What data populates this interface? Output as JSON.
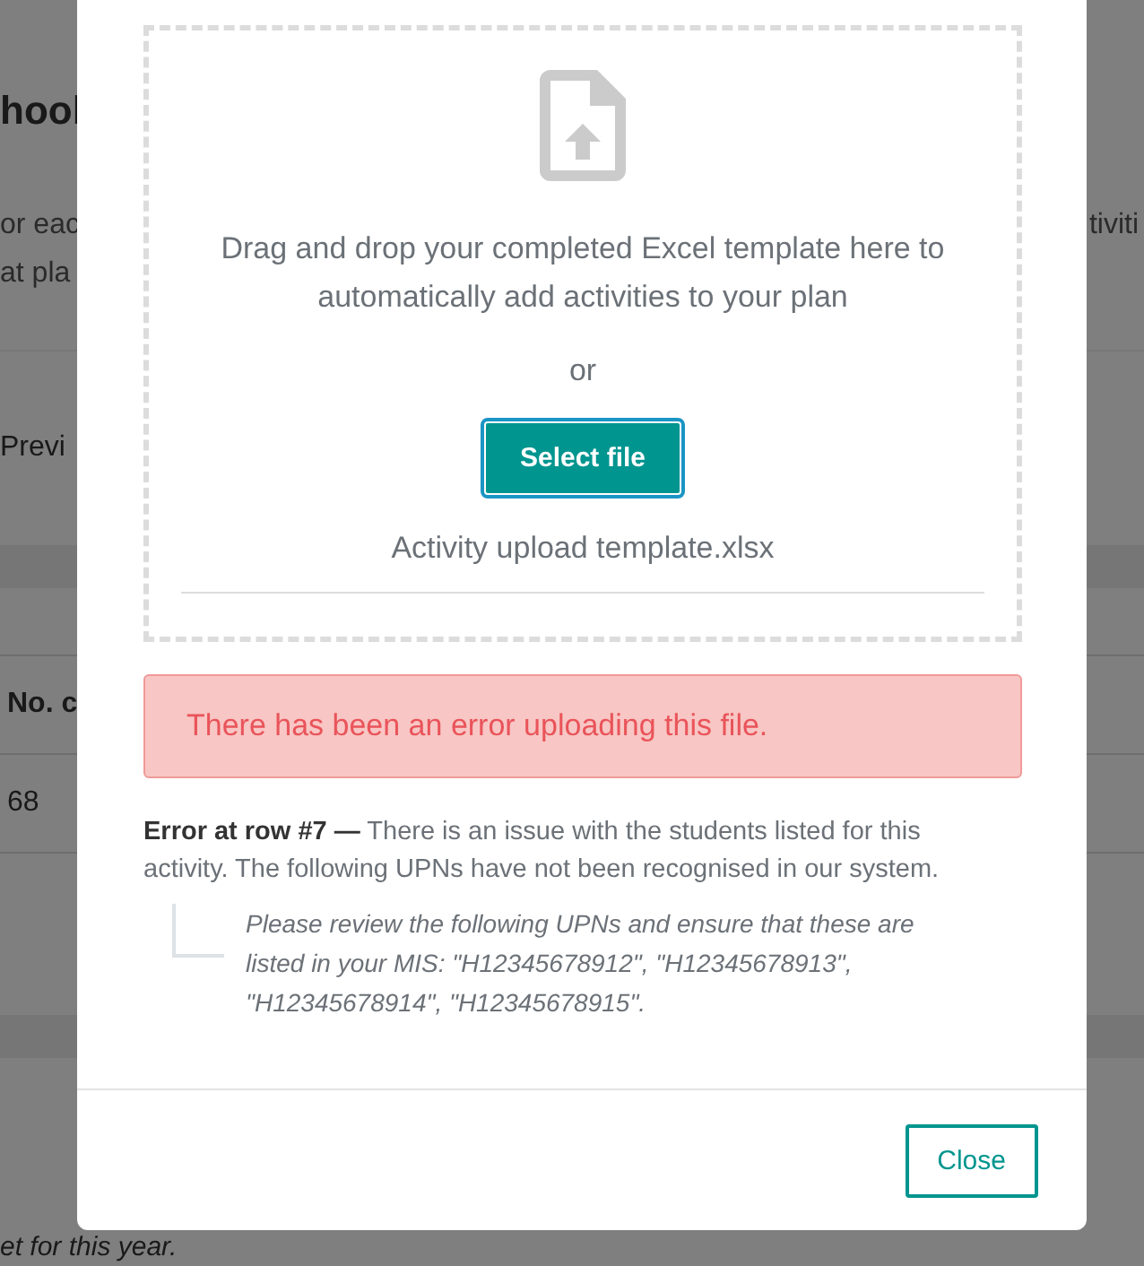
{
  "background": {
    "heading": "hool",
    "intro_lines": [
      "or eac",
      "at pla"
    ],
    "intro_right": "tiviti",
    "link": "Previ",
    "table": {
      "columns": [
        "No. c"
      ],
      "rows": [
        [
          "68"
        ]
      ]
    },
    "footer_note": "et for this year."
  },
  "modal": {
    "dropzone": {
      "instructions": "Drag and drop your completed Excel template here to automatically add activities to your plan",
      "separator": "or",
      "button": "Select file",
      "template_name": "Activity upload template.xlsx"
    },
    "alert": "There has been an error uploading this file.",
    "errors": [
      {
        "message": "**Error at row #7 —** There is an issue with the students listed for this activity. The following UPNs have not been recognised in our system.",
        "detail": "Please review the following UPNs and ensure that these are listed in your MIS: \"H12345678912\", \"H12345678913\", \"H12345678914\", \"H12345678915\"."
      }
    ],
    "close_button": "Close"
  }
}
